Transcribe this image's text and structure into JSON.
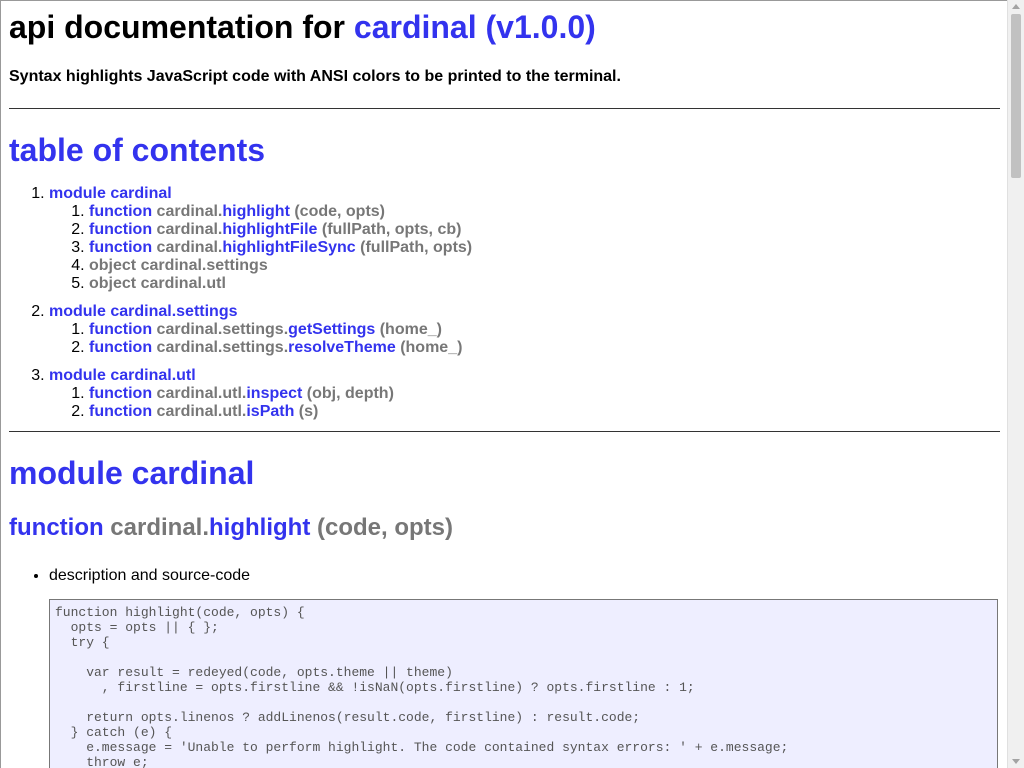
{
  "header": {
    "title_prefix": "api documentation for ",
    "title_name": "cardinal (v1.0.0)",
    "subtitle": "Syntax highlights JavaScript code with ANSI colors to be printed to the terminal."
  },
  "toc": {
    "heading": "table of contents",
    "modules": [
      {
        "label": "module cardinal",
        "items": [
          {
            "kind": "function",
            "prefix": "cardinal.",
            "name": "highlight",
            "args": " (code, opts)"
          },
          {
            "kind": "function",
            "prefix": "cardinal.",
            "name": "highlightFile",
            "args": " (fullPath, opts, cb)"
          },
          {
            "kind": "function",
            "prefix": "cardinal.",
            "name": "highlightFileSync",
            "args": " (fullPath, opts)"
          },
          {
            "kind": "object",
            "text": "object cardinal.settings"
          },
          {
            "kind": "object",
            "text": "object cardinal.utl"
          }
        ]
      },
      {
        "label": "module cardinal.settings",
        "items": [
          {
            "kind": "function",
            "prefix": "cardinal.settings.",
            "name": "getSettings",
            "args": " (home_)"
          },
          {
            "kind": "function",
            "prefix": "cardinal.settings.",
            "name": "resolveTheme",
            "args": " (home_)"
          }
        ]
      },
      {
        "label": "module cardinal.utl",
        "items": [
          {
            "kind": "function",
            "prefix": "cardinal.utl.",
            "name": "inspect",
            "args": " (obj, depth)"
          },
          {
            "kind": "function",
            "prefix": "cardinal.utl.",
            "name": "isPath",
            "args": " (s)"
          }
        ]
      }
    ]
  },
  "section": {
    "heading": "module cardinal",
    "function_heading": {
      "keyword": "function",
      "prefix": " cardinal.",
      "name": "highlight",
      "args": " (code, opts)"
    },
    "description_label": "description and source-code",
    "code": "function highlight(code, opts) {\n  opts = opts || { };\n  try {\n\n    var result = redeyed(code, opts.theme || theme)\n      , firstline = opts.firstline && !isNaN(opts.firstline) ? opts.firstline : 1;\n\n    return opts.linenos ? addLinenos(result.code, firstline) : result.code;\n  } catch (e) {\n    e.message = 'Unable to perform highlight. The code contained syntax errors: ' + e.message;\n    throw e;"
  },
  "colors": {
    "link": "#3333ee",
    "muted": "#777777",
    "code_bg": "#eeeeff"
  }
}
